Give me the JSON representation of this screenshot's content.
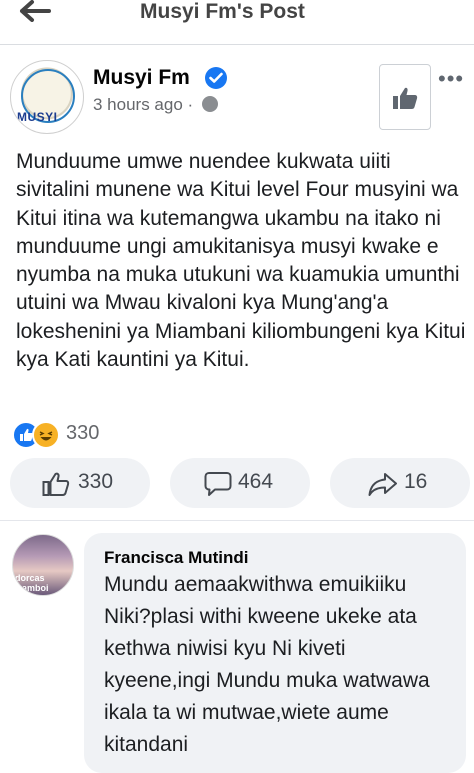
{
  "header": {
    "title": "Musyi Fm's Post"
  },
  "post": {
    "page_name": "Musyi Fm",
    "time": "3 hours ago",
    "separator": "·",
    "avatar_brand": "MUSYI",
    "body": "Munduume umwe nuendee kukwata uiiti sivitalini munene wa Kitui level Four musyini wa Kitui itina wa kutemangwa ukambu na itako ni  munduume ungi amukitanisya musyi kwake e nyumba na muka utukuni wa kuamukia umunthi utuini wa Mwau kivaloni kya Mung'ang'a lokeshenini ya Miambani kiliombungeni kya Kitui kya Kati kauntini ya Kitui."
  },
  "reactions": {
    "count": "330"
  },
  "actions": {
    "like_count": "330",
    "comment_count": "464",
    "share_count": "16"
  },
  "comment": {
    "author": "Francisca Mutindi",
    "text": "Mundu aemaakwithwa emuikiiku Niki?plasi withi kweene ukeke ata kethwa niwisi kyu Ni kiveti kyeene,ingi Mundu muka watwawa ikala ta wi mutwae,wiete aume kitandani",
    "avatar_caption": "dorcas wamboi"
  },
  "colors": {
    "accent": "#1877f2",
    "pill_bg": "#f0f2f5",
    "muted": "#65676b"
  }
}
